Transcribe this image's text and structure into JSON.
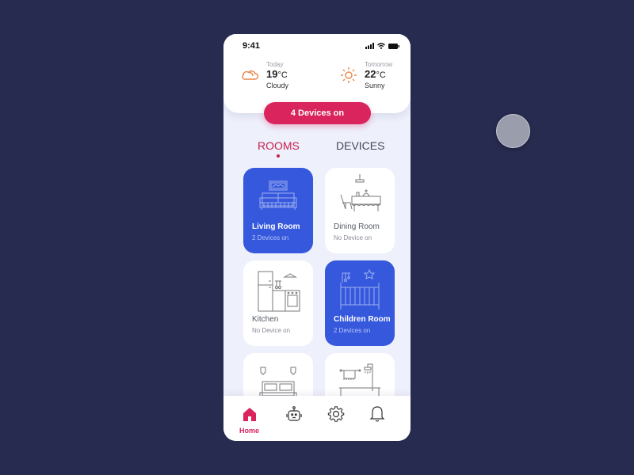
{
  "status_bar": {
    "time": "9:41"
  },
  "weather": {
    "today": {
      "label": "Today",
      "temp": "19",
      "unit": "°C",
      "condition": "Cloudy",
      "icon": "cloud-icon"
    },
    "tomorrow": {
      "label": "Tomorrow",
      "temp": "22",
      "unit": "°C",
      "condition": "Sunny",
      "icon": "sun-icon"
    }
  },
  "devices_on_button": "4 Devices on",
  "tabs": [
    {
      "label": "ROOMS",
      "active": true
    },
    {
      "label": "DEVICES",
      "active": false
    }
  ],
  "rooms": [
    {
      "name": "Living Room",
      "status": "2 Devices on",
      "active": true,
      "icon": "sofa-icon"
    },
    {
      "name": "Dining Room",
      "status": "No Device on",
      "active": false,
      "icon": "dining-table-icon"
    },
    {
      "name": "Kitchen",
      "status": "No Device on",
      "active": false,
      "icon": "kitchen-icon"
    },
    {
      "name": "Children Room",
      "status": "2 Devices on",
      "active": true,
      "icon": "crib-icon"
    },
    {
      "name": "",
      "status": "",
      "active": false,
      "icon": "bed-icon"
    },
    {
      "name": "",
      "status": "",
      "active": false,
      "icon": "bathtub-icon"
    }
  ],
  "bottom_nav": [
    {
      "label": "Home",
      "icon": "home-icon",
      "active": true
    },
    {
      "label": "",
      "icon": "robot-icon",
      "active": false
    },
    {
      "label": "",
      "icon": "gear-icon",
      "active": false
    },
    {
      "label": "",
      "icon": "bell-icon",
      "active": false
    }
  ],
  "colors": {
    "accent": "#d9245d",
    "active_card": "#3558dd",
    "background": "#272b4f",
    "weather_icon": "#e8874a"
  }
}
